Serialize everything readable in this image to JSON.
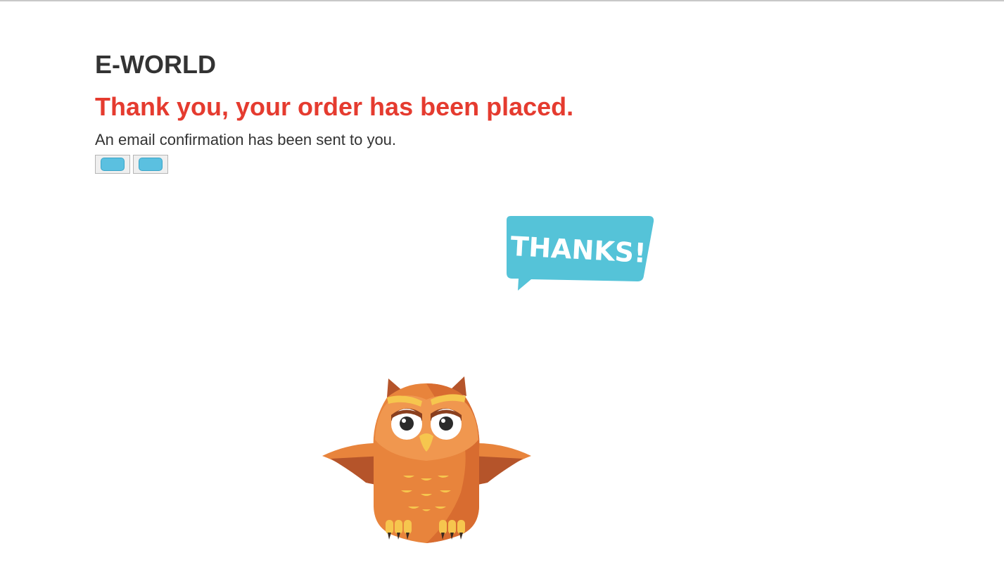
{
  "page": {
    "brand": "E-WORLD",
    "headline": "Thank you, your order has been placed.",
    "subtext": "An email confirmation has been sent to you."
  },
  "buttons": [
    {
      "name": "unlabeled-button-1",
      "label": ""
    },
    {
      "name": "unlabeled-button-2",
      "label": ""
    }
  ],
  "illustration": {
    "speech_bubble_text": "THANKS!",
    "character": "owl-illustration"
  },
  "colors": {
    "brand_text": "#333333",
    "headline": "#e53b2f",
    "bubble": "#55c3d8",
    "owl_body": "#e8843c",
    "owl_wing": "#c8612b"
  }
}
